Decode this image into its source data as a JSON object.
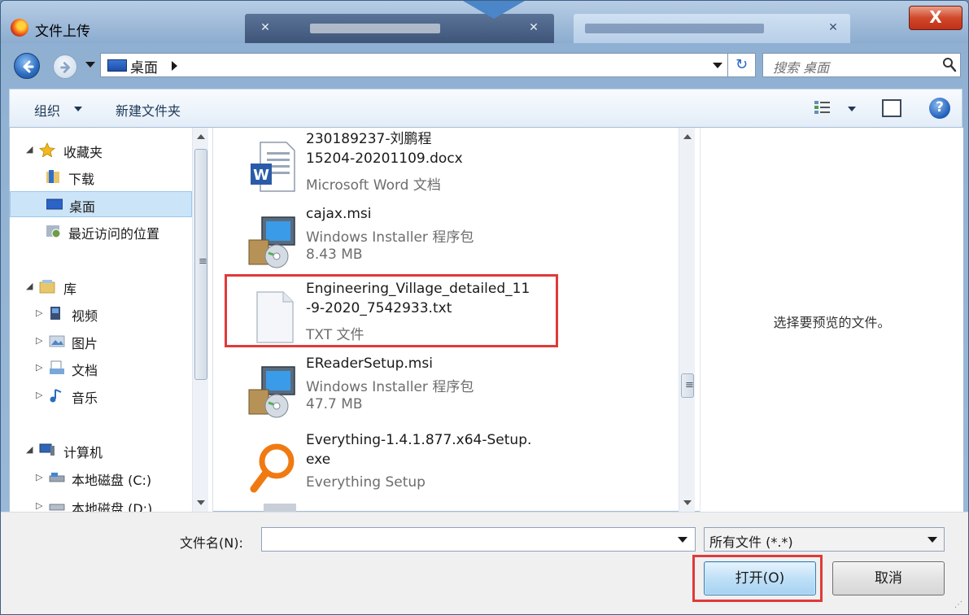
{
  "window": {
    "title": "文件上传",
    "close_label": "X"
  },
  "navigation": {
    "address_location": "桌面",
    "search_placeholder": "搜索 桌面"
  },
  "toolbar": {
    "organize_label": "组织",
    "new_folder_label": "新建文件夹",
    "help_label": "?"
  },
  "sidebar": {
    "favorites": "收藏夹",
    "downloads": "下载",
    "desktop": "桌面",
    "recent": "最近访问的位置",
    "libraries": "库",
    "videos": "视频",
    "pictures": "图片",
    "documents": "文档",
    "music": "音乐",
    "computer": "计算机",
    "drive_c": "本地磁盘 (C:)",
    "drive_d": "本地磁盘 (D:)"
  },
  "files": [
    {
      "name_line1": "230189237-刘鹏程",
      "name_line2": "15204-20201109.docx",
      "type": "Microsoft Word 文档",
      "size": "",
      "icon": "word-doc-icon"
    },
    {
      "name_line1": "cajax.msi",
      "name_line2": "",
      "type": "Windows Installer 程序包",
      "size": "8.43 MB",
      "icon": "msi-installer-icon"
    },
    {
      "name_line1": "Engineering_Village_detailed_11",
      "name_line2": "-9-2020_7542933.txt",
      "type": "TXT 文件",
      "size": "",
      "icon": "text-file-icon"
    },
    {
      "name_line1": "EReaderSetup.msi",
      "name_line2": "",
      "type": "Windows Installer 程序包",
      "size": "47.7 MB",
      "icon": "msi-installer-icon"
    },
    {
      "name_line1": "Everything-1.4.1.877.x64-Setup.",
      "name_line2": "exe",
      "type": "Everything Setup",
      "size": "",
      "icon": "magnifier-app-icon"
    }
  ],
  "preview": {
    "message": "选择要预览的文件。"
  },
  "bottom": {
    "filename_label": "文件名(N):",
    "filename_value": "",
    "filter_value": "所有文件 (*.*)",
    "open_label": "打开(O)",
    "cancel_label": "取消"
  },
  "colors": {
    "highlight": "#e03a3a",
    "selection": "#cce4f7",
    "close_button": "#d0482a"
  }
}
